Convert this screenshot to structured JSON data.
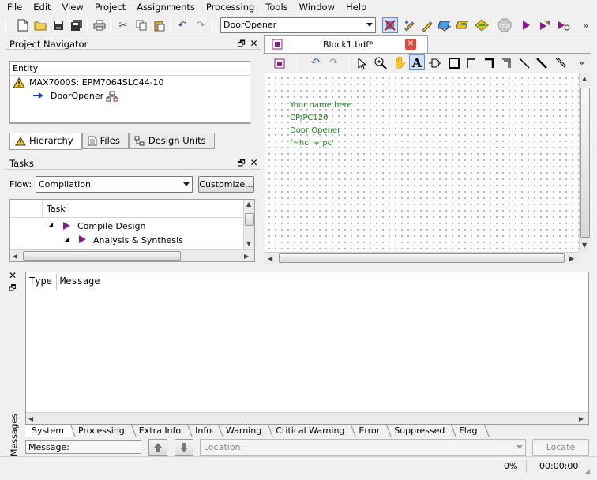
{
  "menu": [
    "File",
    "Edit",
    "View",
    "Project",
    "Assignments",
    "Processing",
    "Tools",
    "Window",
    "Help"
  ],
  "toolbar": {
    "entity_value": "DoorOpener"
  },
  "navigator": {
    "title": "Project Navigator",
    "column_header": "Entity",
    "device": "MAX7000S: EPM7064SLC44-10",
    "top_entity": "DoorOpener",
    "tabs": [
      "Hierarchy",
      "Files",
      "Design Units"
    ]
  },
  "tasks": {
    "title": "Tasks",
    "flow_label": "Flow:",
    "flow_value": "Compilation",
    "customize_label": "Customize...",
    "column_header": "Task",
    "items": [
      "Compile Design",
      "Analysis & Synthesis"
    ]
  },
  "editor": {
    "tab_title": "Block1.bdf*",
    "notes": [
      "Your name here",
      "CP/PC120",
      "Door Opener",
      "f=hc' + pc'"
    ]
  },
  "messages": {
    "header_type": "Type",
    "header_message": "Message",
    "side_label": "Messages",
    "tabs": [
      "System",
      "Processing",
      "Extra Info",
      "Info",
      "Warning",
      "Critical Warning",
      "Error",
      "Suppressed",
      "Flag"
    ],
    "message_label": "Message:",
    "location_placeholder": "Location:",
    "locate_label": "Locate"
  },
  "status": {
    "progress": "0%",
    "elapsed": "00:00:00"
  },
  "colors": {
    "note_green": "#1a8a1a",
    "task_arrow": "#8b1a8b",
    "warning": "#f5c400"
  }
}
